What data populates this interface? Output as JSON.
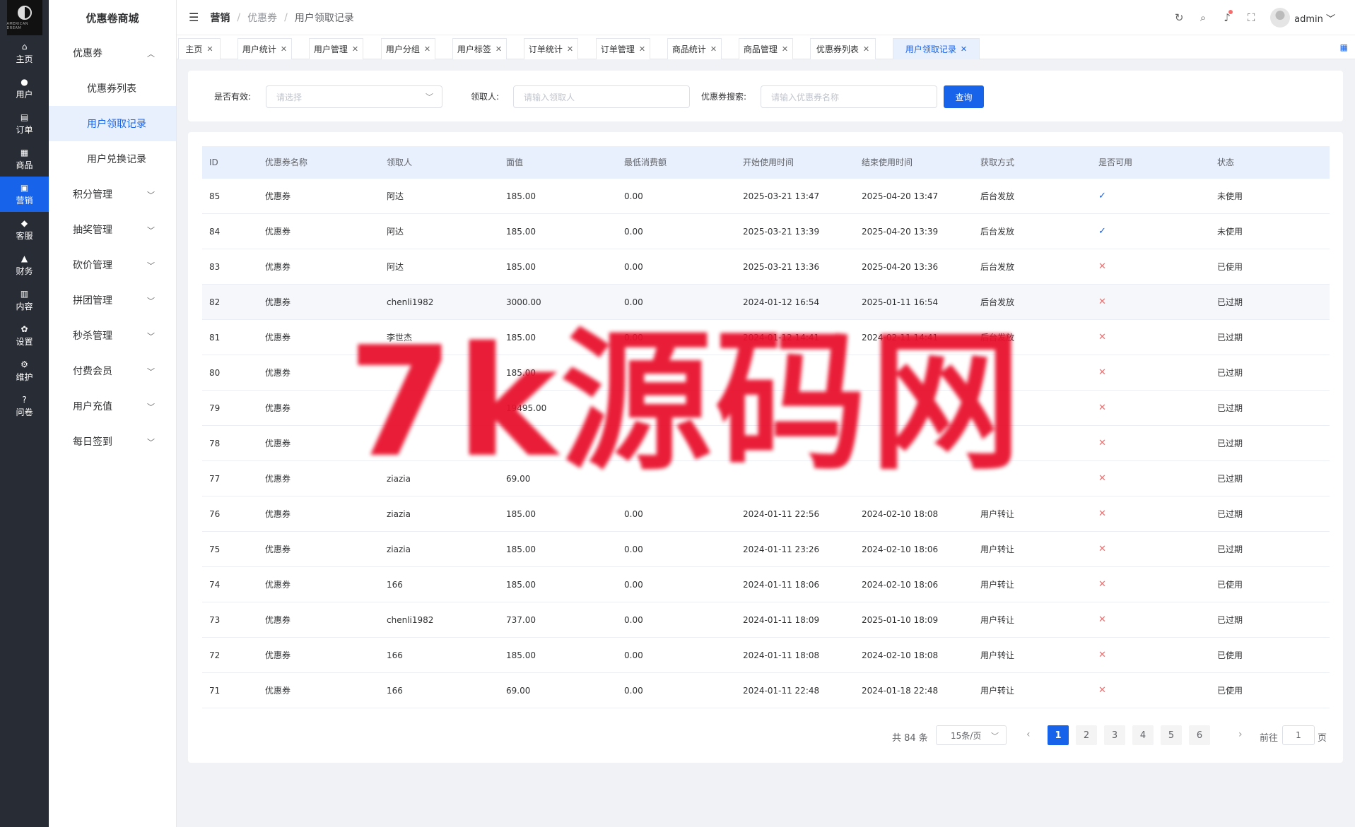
{
  "rail": {
    "logo_text": "AMERICAN DREAM",
    "items": [
      {
        "label": "主页",
        "icon": "home-icon",
        "glyph": "⌂"
      },
      {
        "label": "用户",
        "icon": "user-icon",
        "glyph": "●"
      },
      {
        "label": "订单",
        "icon": "order-icon",
        "glyph": "▤"
      },
      {
        "label": "商品",
        "icon": "goods-icon",
        "glyph": "▦"
      },
      {
        "label": "营销",
        "icon": "marketing-icon",
        "glyph": "▣"
      },
      {
        "label": "客服",
        "icon": "service-icon",
        "glyph": "◆"
      },
      {
        "label": "财务",
        "icon": "finance-icon",
        "glyph": "▲"
      },
      {
        "label": "内容",
        "icon": "content-icon",
        "glyph": "▥"
      },
      {
        "label": "设置",
        "icon": "settings-icon",
        "glyph": "✿"
      },
      {
        "label": "维护",
        "icon": "maintain-icon",
        "glyph": "⚙"
      },
      {
        "label": "问卷",
        "icon": "survey-icon",
        "glyph": "?"
      }
    ]
  },
  "submenu": {
    "brand": "优惠卷商城",
    "coupon": "优惠券",
    "coupon_list": "优惠券列表",
    "user_receive": "用户领取记录",
    "user_exchange": "用户兑换记录",
    "groups": [
      "积分管理",
      "抽奖管理",
      "砍价管理",
      "拼团管理",
      "秒杀管理",
      "付费会员",
      "用户充值",
      "每日签到"
    ]
  },
  "header": {
    "crumb1": "营销",
    "crumb2": "优惠券",
    "crumb3": "用户领取记录",
    "user": "admin"
  },
  "tabs": [
    "主页",
    "用户统计",
    "用户管理",
    "用户分组",
    "用户标签",
    "订单统计",
    "订单管理",
    "商品统计",
    "商品管理",
    "优惠券列表",
    "用户领取记录"
  ],
  "filter": {
    "valid_label": "是否有效:",
    "valid_placeholder": "请选择",
    "receiver_label": "领取人:",
    "receiver_placeholder": "请输入领取人",
    "search_label": "优惠券搜索:",
    "search_placeholder": "请输入优惠券名称",
    "query_label": "查询"
  },
  "table": {
    "columns": [
      "ID",
      "优惠券名称",
      "领取人",
      "面值",
      "最低消费额",
      "开始使用时间",
      "结束使用时间",
      "获取方式",
      "是否可用",
      "状态"
    ],
    "rows": [
      [
        "85",
        "优惠券",
        "阿达",
        "185.00",
        "0.00",
        "2025-03-21 13:47",
        "2025-04-20 13:47",
        "后台发放",
        "yes",
        "未使用"
      ],
      [
        "84",
        "优惠券",
        "阿达",
        "185.00",
        "0.00",
        "2025-03-21 13:39",
        "2025-04-20 13:39",
        "后台发放",
        "yes",
        "未使用"
      ],
      [
        "83",
        "优惠券",
        "阿达",
        "185.00",
        "0.00",
        "2025-03-21 13:36",
        "2025-04-20 13:36",
        "后台发放",
        "no",
        "已使用"
      ],
      [
        "82",
        "优惠券",
        "chenli1982",
        "3000.00",
        "0.00",
        "2024-01-12 16:54",
        "2025-01-11 16:54",
        "后台发放",
        "no",
        "已过期"
      ],
      [
        "81",
        "优惠券",
        "李世杰",
        "185.00",
        "0.00",
        "2024-01-12 14:41",
        "2024-02-11 14:41",
        "后台发放",
        "no",
        "已过期"
      ],
      [
        "80",
        "优惠券",
        "",
        "185.00",
        "",
        "",
        "",
        "",
        "no",
        "已过期"
      ],
      [
        "79",
        "优惠券",
        "",
        "19495.00",
        "",
        "",
        "",
        "",
        "no",
        "已过期"
      ],
      [
        "78",
        "优惠券",
        "",
        "",
        "",
        "",
        "",
        "",
        "no",
        "已过期"
      ],
      [
        "77",
        "优惠券",
        "ziazia",
        "69.00",
        "",
        "",
        "",
        "",
        "no",
        "已过期"
      ],
      [
        "76",
        "优惠券",
        "ziazia",
        "185.00",
        "0.00",
        "2024-01-11 22:56",
        "2024-02-10 18:08",
        "用户转让",
        "no",
        "已过期"
      ],
      [
        "75",
        "优惠券",
        "ziazia",
        "185.00",
        "0.00",
        "2024-01-11 23:26",
        "2024-02-10 18:06",
        "用户转让",
        "no",
        "已过期"
      ],
      [
        "74",
        "优惠券",
        "166",
        "185.00",
        "0.00",
        "2024-01-11 18:06",
        "2024-02-10 18:06",
        "用户转让",
        "no",
        "已使用"
      ],
      [
        "73",
        "优惠券",
        "chenli1982",
        "737.00",
        "0.00",
        "2024-01-11 18:09",
        "2025-01-10 18:09",
        "用户转让",
        "no",
        "已过期"
      ],
      [
        "72",
        "优惠券",
        "166",
        "185.00",
        "0.00",
        "2024-01-11 18:08",
        "2024-02-10 18:08",
        "用户转让",
        "no",
        "已使用"
      ],
      [
        "71",
        "优惠券",
        "166",
        "69.00",
        "0.00",
        "2024-01-11 22:48",
        "2024-01-18 22:48",
        "用户转让",
        "no",
        "已使用"
      ]
    ]
  },
  "pager": {
    "total": "共 84 条",
    "size": "15条/页",
    "pages": [
      "1",
      "2",
      "3",
      "4",
      "5",
      "6"
    ],
    "goto": "前往",
    "jump": "1",
    "page": "页"
  },
  "watermark": "7k源码网",
  "colors": {
    "primary": "#1763ea",
    "rail": "#282c34",
    "danger": "#f56c6c"
  }
}
